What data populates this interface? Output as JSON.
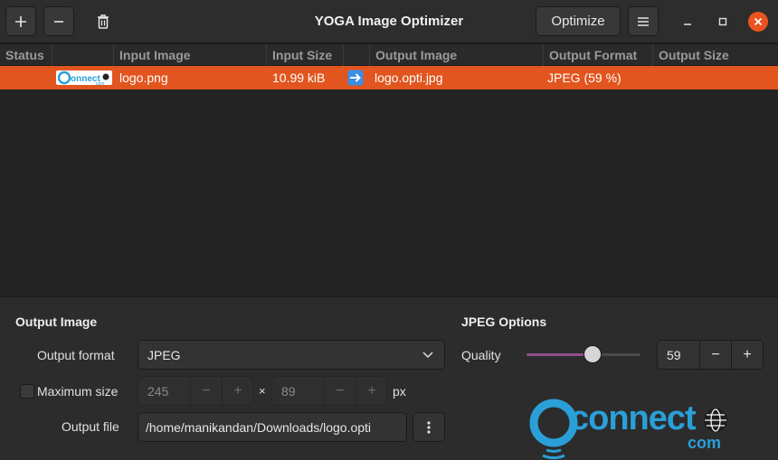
{
  "window": {
    "title": "YOGA Image Optimizer",
    "optimize_label": "Optimize",
    "add_icon": "plus-icon",
    "remove_icon": "minus-icon",
    "clear_icon": "trash-icon",
    "menu_icon": "hamburger-menu-icon",
    "accent": "#e95420"
  },
  "table": {
    "headers": {
      "status": "Status",
      "input_image": "Input Image",
      "input_size": "Input Size",
      "output_image": "Output Image",
      "output_format": "Output Format",
      "output_size": "Output Size"
    },
    "rows": [
      {
        "input_image": "logo.png",
        "input_size": "10.99 kiB",
        "arrow_icon": "right-arrow-icon",
        "output_image": "logo.opti.jpg",
        "output_format": "JPEG (59 %)",
        "output_size": "",
        "selected": true,
        "selection_color": "#e2551f"
      }
    ]
  },
  "output_image": {
    "heading": "Output Image",
    "format_label": "Output format",
    "format_value": "JPEG",
    "max_size_label": "Maximum size",
    "max_size_checked": false,
    "width_value": "245",
    "height_value": "89",
    "times_sign": "×",
    "unit": "px",
    "file_label": "Output file",
    "file_value": "/home/manikandan/Downloads/logo.opti"
  },
  "jpeg_options": {
    "heading": "JPEG Options",
    "quality_label": "Quality",
    "quality_value": "59",
    "quality_fraction": 0.59,
    "slider_color": "#924d8b"
  },
  "watermark": {
    "text": "connect",
    "sub": "com"
  }
}
